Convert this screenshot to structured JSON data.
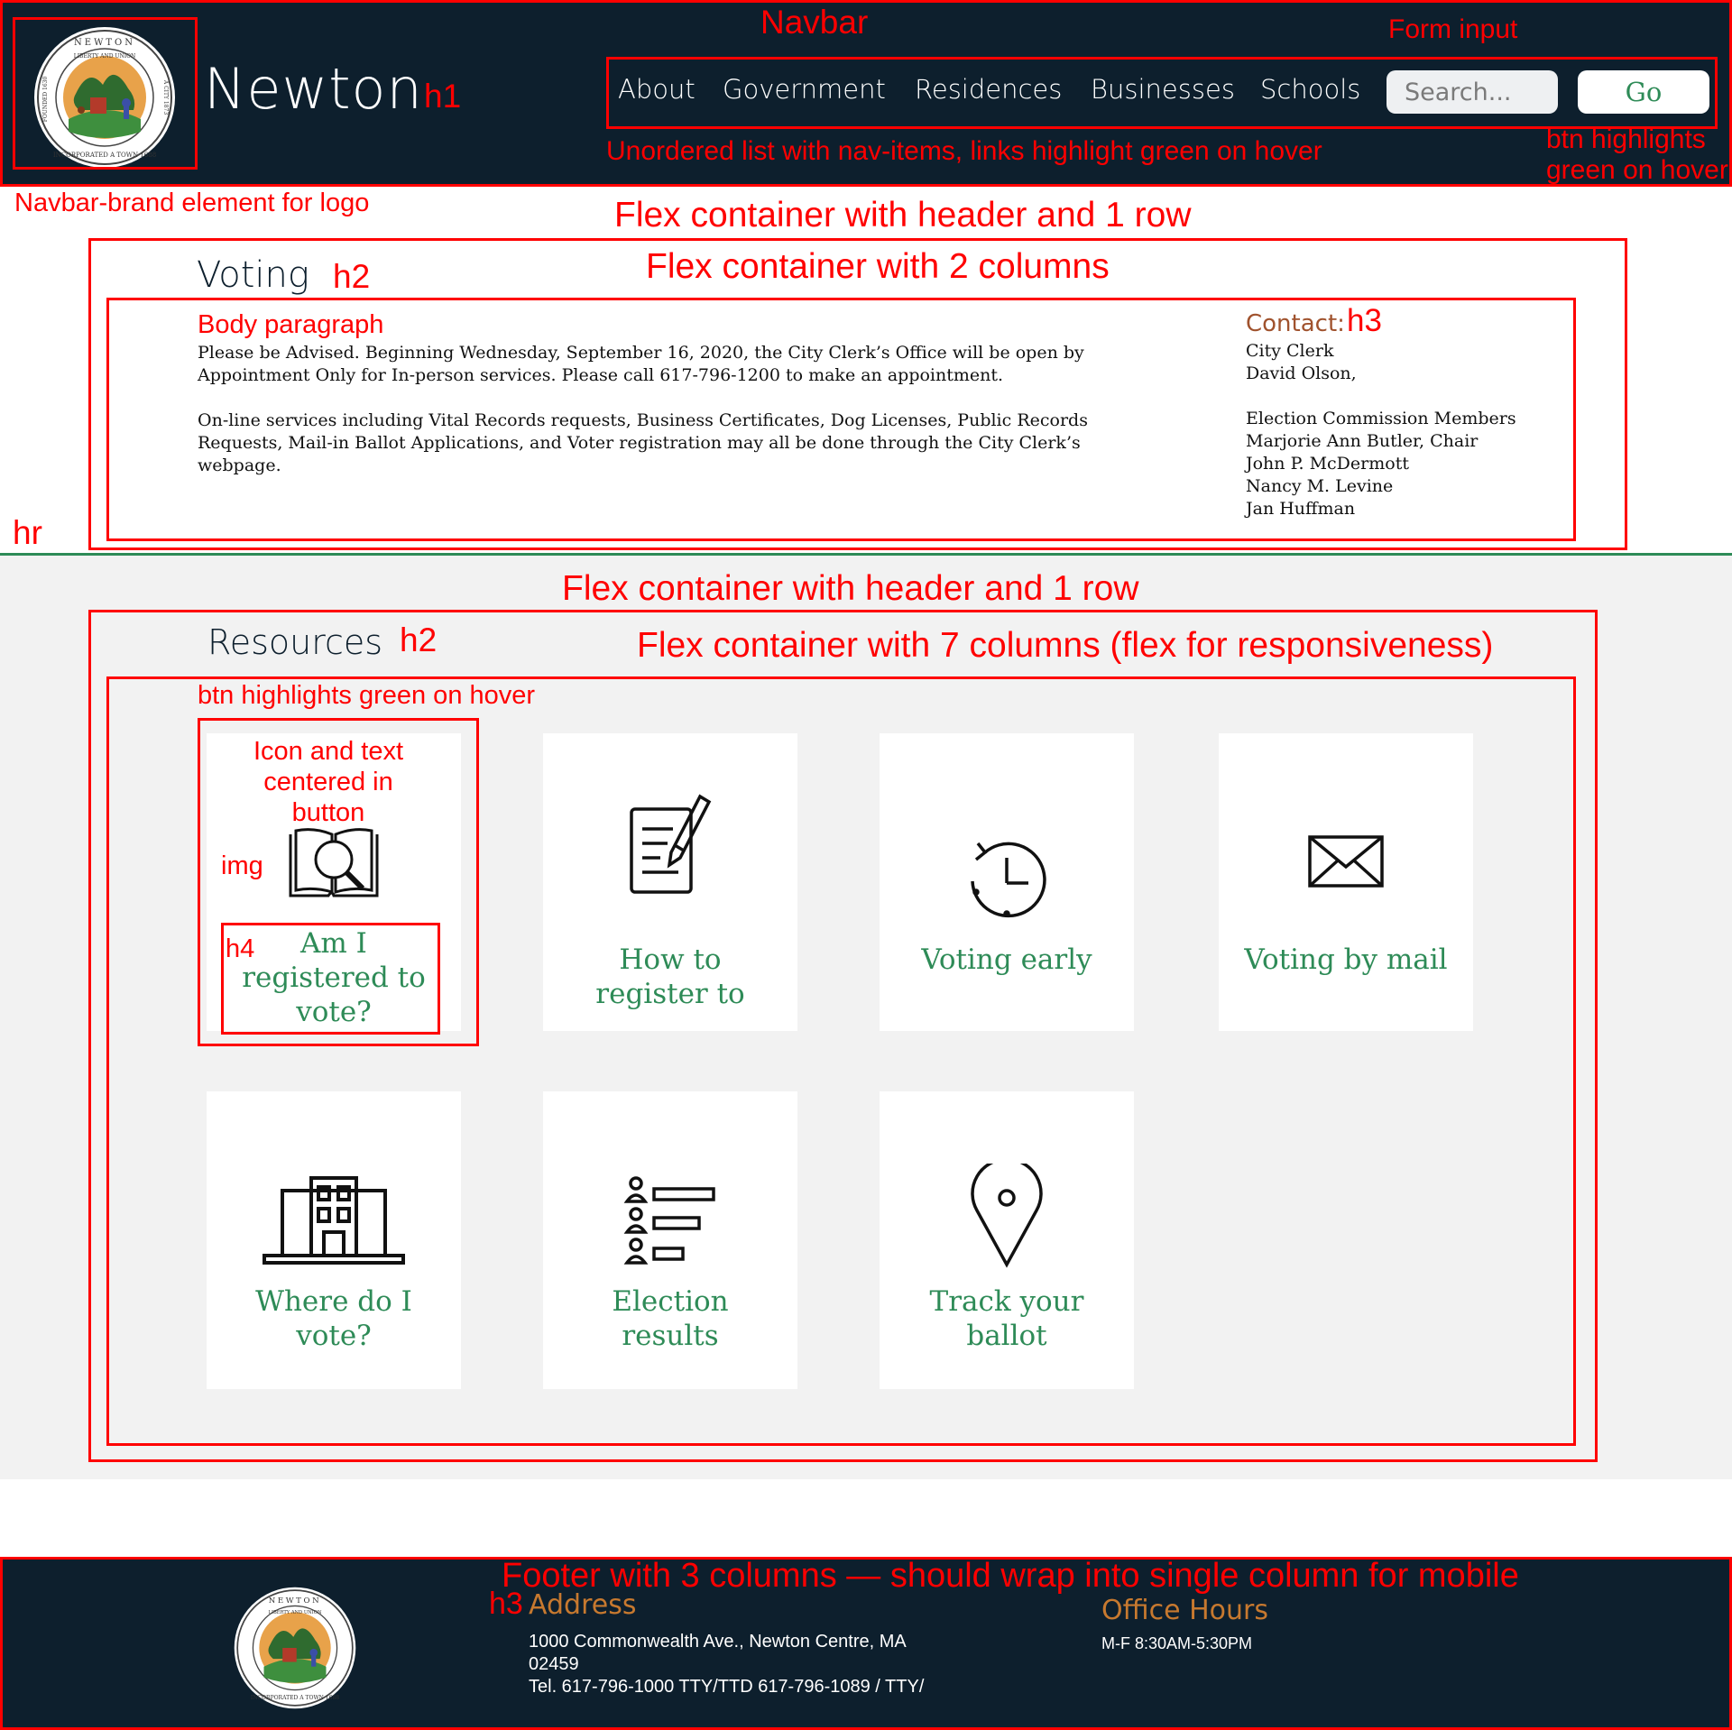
{
  "navbar": {
    "brand": "Newton",
    "links": [
      "About",
      "Government",
      "Residences",
      "Businesses",
      "Schools"
    ],
    "search_placeholder": "Search...",
    "go_label": "Go"
  },
  "voting": {
    "heading": "Voting",
    "paragraph1_line1": "Please be Advised.  Beginning Wednesday, September 16, 2020, the City Clerk’s Office will be open by",
    "paragraph1_line2": "Appointment Only for In-person services.  Please call 617-796-1200 to make an appointment.",
    "paragraph2_line1": "On-line services including Vital Records requests, Business Certificates, Dog Licenses, Public Records",
    "paragraph2_line2": "Requests, Mail-in Ballot Applications, and Voter registration may all be done through the City Clerk’s",
    "paragraph2_line3": "webpage.",
    "contact_heading": "Contact:",
    "contact_lines": [
      "City Clerk",
      "David Olson,",
      "",
      "Election Commission Members",
      "Marjorie Ann Butler, Chair",
      "John P. McDermott",
      "Nancy M. Levine",
      "Jan Huffman"
    ]
  },
  "resources": {
    "heading": "Resources",
    "cards": [
      {
        "label_lines": [
          "Am I",
          "registered to",
          "vote?"
        ],
        "icon": "book-search-icon"
      },
      {
        "label_lines": [
          "How to",
          "register to"
        ],
        "icon": "document-pen-icon"
      },
      {
        "label_lines": [
          "Voting early"
        ],
        "icon": "clock-history-icon"
      },
      {
        "label_lines": [
          "Voting by mail"
        ],
        "icon": "envelope-icon"
      },
      {
        "label_lines": [
          "Where do I",
          "vote?"
        ],
        "icon": "building-icon"
      },
      {
        "label_lines": [
          "Election",
          "results"
        ],
        "icon": "results-list-icon"
      },
      {
        "label_lines": [
          "Track your",
          "ballot"
        ],
        "icon": "map-pin-icon"
      }
    ]
  },
  "footer": {
    "address_heading": "Address",
    "address_line1": "1000 Commonwealth Ave., Newton Centre, MA",
    "address_line2": "02459",
    "address_line3": "Tel. 617-796-1000 TTY/TTD 617-796-1089 / TTY/",
    "hours_heading": "Office Hours",
    "hours_text": "M-F 8:30AM-5:30PM"
  },
  "seal": {
    "top_text": "NEWTON",
    "inner_text": "LIBERTY AND UNION",
    "left_text": "FOUNDED 1630",
    "bottom_text": "INCORPORATED A TOWN 1688",
    "right_text": "A CITY 1873"
  },
  "annotations": {
    "navbar": "Navbar",
    "form_input": "Form input",
    "h1": "h1",
    "nav_list": "Unordered list with nav-items, links highlight green on hover",
    "btn_highlight_1": "btn highlights",
    "btn_highlight_2": "green on hover",
    "brand_logo": "Navbar-brand element for logo",
    "flex_header_row": "Flex container with header and 1 row",
    "flex_2_cols": "Flex container with 2 columns",
    "h2": "h2",
    "body_paragraph": "Body paragraph",
    "h3": "h3",
    "hr": "hr",
    "flex_header_row_2": "Flex container with header and 1 row",
    "h2_b": "h2",
    "flex_7_cols": "Flex container with 7 columns (flex for responsiveness)",
    "btn_hover": "btn highlights green on hover",
    "icon_text_1": "Icon and text",
    "icon_text_2": "centered in",
    "icon_text_3": "button",
    "img": "img",
    "h4": "h4",
    "footer": "Footer with 3 columns — should wrap into single column for mobile",
    "h3_footer": "h3"
  },
  "colors": {
    "navy": "#0d1f2d",
    "green": "#2e8b57",
    "orange": "#c7792f",
    "annotation_red": "#ff0000"
  }
}
